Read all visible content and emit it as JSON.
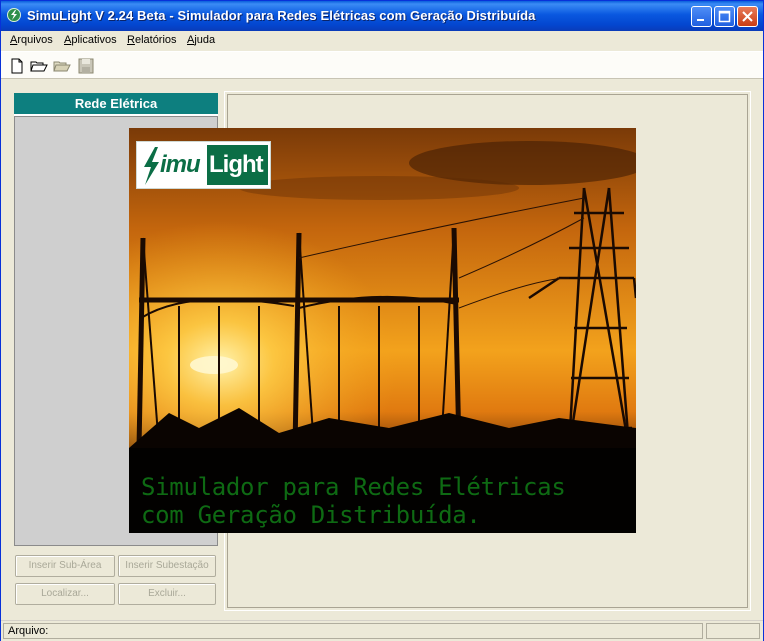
{
  "window": {
    "title": "SimuLight V 2.24 Beta - Simulador para Redes Elétricas com Geração Distribuída"
  },
  "menu": [
    {
      "label": "Arquivos",
      "mnemonic": "A",
      "rest": "rquivos"
    },
    {
      "label": "Aplicativos",
      "mnemonic": "A",
      "rest": "plicativos"
    },
    {
      "label": "Relatórios",
      "mnemonic": "R",
      "rest": "elatórios"
    },
    {
      "label": "Ajuda",
      "mnemonic": "A",
      "rest": "juda"
    }
  ],
  "toolbar": {
    "icons": [
      "new-file-icon",
      "open-folder-icon",
      "open-recent-folder-icon",
      "save-disk-icon"
    ]
  },
  "left_panel": {
    "title": "Rede Elétrica",
    "buttons": {
      "insert_subarea": "Inserir Sub-Área",
      "insert_substation": "Inserir Subestação",
      "locate": "Localizar...",
      "delete": "Excluir..."
    }
  },
  "splash": {
    "logo_simu": "imu",
    "logo_light": "Light",
    "tagline_line1": "Simulador para Redes Elétricas",
    "tagline_line2": "com Geração Distribuída."
  },
  "status": {
    "file_label": "Arquivo:"
  },
  "colors": {
    "titlebar": "#0a58e0",
    "panel_header": "#0d7f7f",
    "logo_green": "#0b6e46",
    "tagline_green": "#0e6a13"
  }
}
